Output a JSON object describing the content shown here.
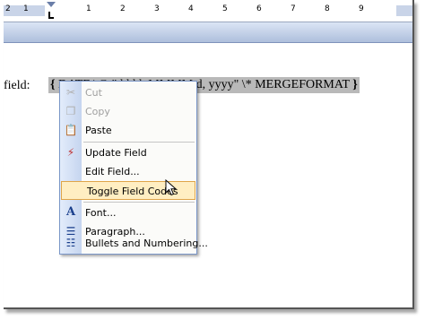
{
  "ruler": {
    "numbers": [
      "2",
      "1",
      "1",
      "2",
      "3",
      "4",
      "5",
      "6",
      "7",
      "8",
      "9"
    ]
  },
  "document": {
    "field_label": "field:",
    "field_code_open": "{",
    "field_code_text": "DATE \\@ \"dddd, MMMM d, yyyy\"  \\* MERGEFORMAT",
    "field_code_visible": "dd, yyyy\"  \\* MERGEFORMAT",
    "field_code_close": "}"
  },
  "menu": {
    "items": [
      {
        "label": "Cut",
        "icon": "scissors-icon",
        "disabled": true
      },
      {
        "label": "Copy",
        "icon": "copy-icon",
        "disabled": true
      },
      {
        "label": "Paste",
        "icon": "clipboard-icon",
        "disabled": false
      },
      {
        "label": "Update Field",
        "icon": "update-field-icon",
        "disabled": false
      },
      {
        "label": "Edit Field...",
        "icon": "",
        "disabled": false
      },
      {
        "label": "Toggle Field Codes",
        "icon": "",
        "disabled": false,
        "highlighted": true
      },
      {
        "label": "Font...",
        "icon": "font-A-icon",
        "disabled": false
      },
      {
        "label": "Paragraph...",
        "icon": "paragraph-icon",
        "disabled": false
      },
      {
        "label": "Bullets and Numbering...",
        "icon": "bullets-icon",
        "disabled": false
      }
    ]
  },
  "colors": {
    "highlight_bg": "#ffeec2",
    "highlight_border": "#dfa54a",
    "field_shade": "#b9b9b9",
    "menu_gutter": "#c5d5ef"
  }
}
